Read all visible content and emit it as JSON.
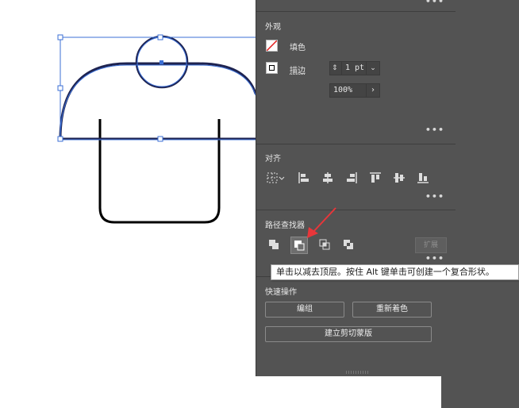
{
  "appearance": {
    "title": "外观",
    "fill_label": "填色",
    "stroke_label": "描边",
    "stroke_weight": "1 pt",
    "opacity": "100%",
    "stroke_color": "#000000",
    "fill_color": "none"
  },
  "align": {
    "title": "对齐",
    "icons": [
      "align-to-selection-icon",
      "align-left-icon",
      "align-horizontal-center-icon",
      "align-right-icon",
      "align-top-icon",
      "align-vertical-center-icon",
      "align-bottom-icon"
    ]
  },
  "pathfinder": {
    "title": "路径查找器",
    "icons": [
      "unite-icon",
      "minus-front-icon",
      "intersect-icon",
      "exclude-icon"
    ],
    "active": "minus-front-icon",
    "expand_label": "扩展"
  },
  "quick_actions": {
    "title": "快速操作",
    "group_label": "编组",
    "recolor_label": "重新着色",
    "clip_mask_label": "建立剪切蒙版"
  },
  "tooltip": {
    "text": "单击以减去顶层。按住 Alt 键单击可创建一个复合形状。"
  },
  "more_label": "•••",
  "colors": {
    "panel_bg": "#535353",
    "selection_blue": "#3b6fd6",
    "arrow_red": "#e8363a"
  }
}
